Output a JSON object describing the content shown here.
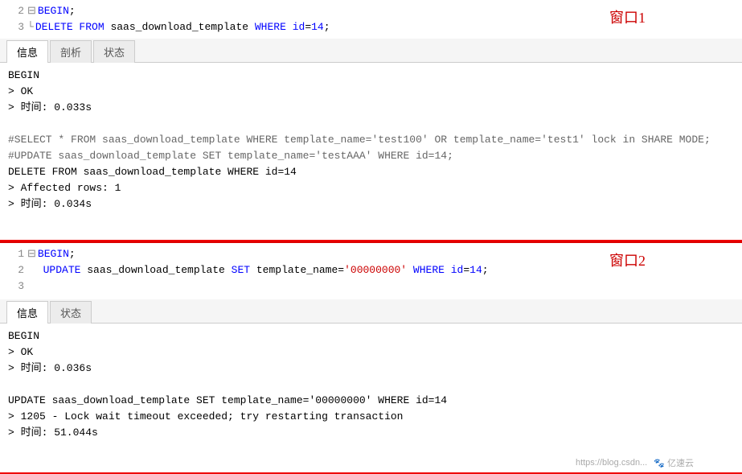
{
  "window1": {
    "label": "窗口1",
    "code_lines": [
      {
        "num": "2",
        "collapse": true,
        "content": "BEGIN;",
        "keywords": [
          {
            "word": "BEGIN",
            "color": "blue"
          }
        ]
      },
      {
        "num": "3",
        "collapse": false,
        "indent": "└",
        "content": "DELETE FROM saas_download_template WHERE id=14;",
        "keywords": [
          {
            "word": "DELETE FROM",
            "color": "blue"
          },
          {
            "word": "WHERE",
            "color": "blue"
          },
          {
            "word": "id",
            "color": "blue"
          },
          {
            "word": "14",
            "color": "red"
          }
        ]
      }
    ],
    "tabs": [
      "信息",
      "剖析",
      "状态"
    ],
    "active_tab": 0,
    "output_lines": [
      {
        "text": "BEGIN",
        "type": "normal"
      },
      {
        "text": "> OK",
        "type": "arrow"
      },
      {
        "text": "> 时间: 0.033s",
        "type": "arrow"
      },
      {
        "text": "",
        "type": "normal"
      },
      {
        "text": "#SELECT * FROM saas_download_template WHERE template_name='test100' OR template_name='test1' lock in SHARE MODE;",
        "type": "comment"
      },
      {
        "text": "#UPDATE saas_download_template SET template_name='testAAA' WHERE id=14;",
        "type": "comment"
      },
      {
        "text": "DELETE FROM saas_download_template WHERE id=14",
        "type": "normal"
      },
      {
        "text": "> Affected rows: 1",
        "type": "arrow"
      },
      {
        "text": "> 时间: 0.034s",
        "type": "arrow"
      }
    ]
  },
  "window2": {
    "label": "窗口2",
    "code_lines": [
      {
        "num": "1",
        "collapse": true,
        "content": "BEGIN;",
        "keywords": [
          {
            "word": "BEGIN",
            "color": "blue"
          }
        ]
      },
      {
        "num": "2",
        "indent": "  ",
        "content": "UPDATE saas_download_template SET template_name='00000000' WHERE id=14;"
      },
      {
        "num": "3",
        "content": ""
      }
    ],
    "tabs": [
      "信息",
      "状态"
    ],
    "active_tab": 0,
    "output_lines": [
      {
        "text": "BEGIN",
        "type": "normal"
      },
      {
        "text": "> OK",
        "type": "arrow"
      },
      {
        "text": "> 时间: 0.036s",
        "type": "arrow"
      },
      {
        "text": "",
        "type": "normal"
      },
      {
        "text": "UPDATE saas_download_template SET template_name='00000000' WHERE id=14",
        "type": "normal"
      },
      {
        "text": "> 1205 - Lock wait timeout exceeded; try restarting transaction",
        "type": "arrow"
      },
      {
        "text": "> 时间: 51.044s",
        "type": "arrow"
      }
    ]
  },
  "watermark": {
    "text": "亿速云"
  }
}
